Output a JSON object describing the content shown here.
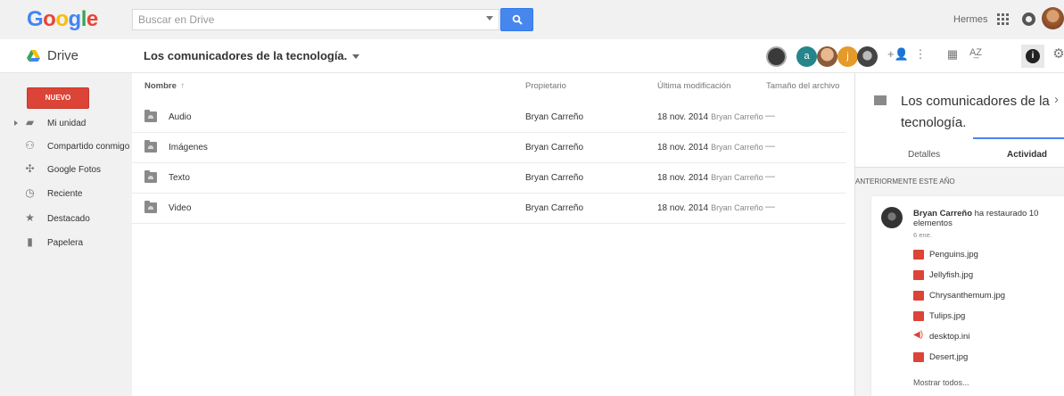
{
  "app": {
    "logo": "Google",
    "product": "Drive"
  },
  "search": {
    "placeholder": "Buscar en Drive"
  },
  "account": {
    "name": "Hermes"
  },
  "folder": {
    "title": "Los comunicadores de la tecnología."
  },
  "collaborators": [
    {
      "initial": "",
      "color": "#3a3a3a"
    },
    {
      "initial": "a",
      "color": "#25858a"
    },
    {
      "initial": "",
      "color": "#d8a070"
    },
    {
      "initial": "j",
      "color": "#e59a2a"
    },
    {
      "initial": "",
      "color": "#4a4a4a"
    }
  ],
  "sidebar": {
    "new_button": "NUEVO",
    "items": [
      {
        "label": "Mi unidad",
        "icon": "my-drive-icon"
      },
      {
        "label": "Compartido conmigo",
        "icon": "shared-icon"
      },
      {
        "label": "Google Fotos",
        "icon": "photos-icon"
      },
      {
        "label": "Reciente",
        "icon": "clock-icon"
      },
      {
        "label": "Destacado",
        "icon": "star-icon"
      },
      {
        "label": "Papelera",
        "icon": "trash-icon"
      }
    ]
  },
  "table": {
    "headers": {
      "name": "Nombre",
      "sort_arrow": "↑",
      "owner": "Propietario",
      "modified": "Última modificación",
      "size": "Tamaño del archivo"
    },
    "rows": [
      {
        "name": "Audio",
        "owner": "Bryan Carreño",
        "date": "18 nov. 2014",
        "by": "Bryan Carreño",
        "size": "—"
      },
      {
        "name": "Imágenes",
        "owner": "Bryan Carreño",
        "date": "18 nov. 2014",
        "by": "Bryan Carreño",
        "size": "—"
      },
      {
        "name": "Texto",
        "owner": "Bryan Carreño",
        "date": "18 nov. 2014",
        "by": "Bryan Carreño",
        "size": "—"
      },
      {
        "name": "Video",
        "owner": "Bryan Carreño",
        "date": "18 nov. 2014",
        "by": "Bryan Carreño",
        "size": "—"
      }
    ]
  },
  "details": {
    "title": "Los comunicadores de la tecnología.",
    "close": "›",
    "tabs": {
      "details": "Detalles",
      "activity": "Actividad"
    },
    "section": "ANTERIORMENTE ESTE AÑO",
    "activity": {
      "user": "Bryan Carreño",
      "action": "ha restaurado 10 elementos",
      "date": "6 ene.",
      "files": [
        {
          "name": "Penguins.jpg",
          "type": "image"
        },
        {
          "name": "Jellyfish.jpg",
          "type": "image"
        },
        {
          "name": "Chrysanthemum.jpg",
          "type": "image"
        },
        {
          "name": "Tulips.jpg",
          "type": "image"
        },
        {
          "name": "desktop.ini",
          "type": "audio"
        },
        {
          "name": "Desert.jpg",
          "type": "image"
        }
      ],
      "show_all": "Mostrar todos..."
    }
  },
  "colors": {
    "accent_blue": "#4787ed",
    "new_red": "#db4437"
  }
}
